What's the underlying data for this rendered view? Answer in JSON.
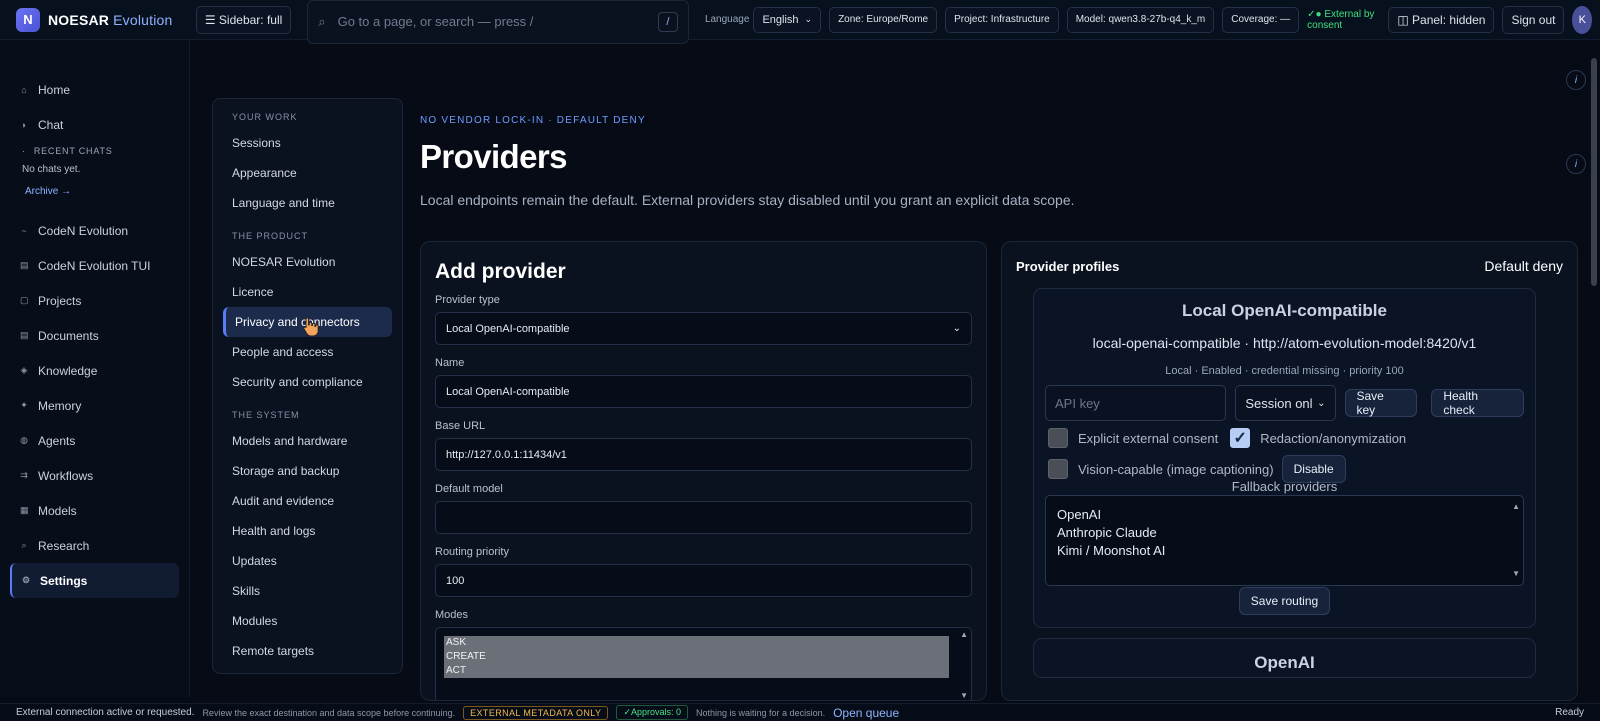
{
  "app": {
    "logo_letter": "N",
    "name": "NOESAR",
    "name_sub": "Evolution"
  },
  "topbar": {
    "sidebar_toggle": "☰ Sidebar: full",
    "search_placeholder": "Go to a page, or search — press /",
    "search_shortcut": "/",
    "language_label": "Language",
    "language_value": "English",
    "zone": "Zone: Europe/Rome",
    "project": "Project: Infrastructure",
    "model": "Model: qwen3.8-27b-q4_k_m",
    "coverage": "Coverage: —",
    "external": "✓● External by consent",
    "panel": "◫ Panel: hidden",
    "sign_out": "Sign out",
    "avatar": "K"
  },
  "sidebar": {
    "items_top": [
      {
        "icon": "⌂",
        "label": "Home"
      },
      {
        "icon": "◗",
        "label": "Chat"
      }
    ],
    "recent_heading": "RECENT CHATS",
    "recent_empty": "No chats yet.",
    "archive": "Archive →",
    "items": [
      {
        "icon": "~",
        "label": "CodeN Evolution"
      },
      {
        "icon": "▤",
        "label": "CodeN Evolution TUI"
      },
      {
        "icon": "▢",
        "label": "Projects"
      },
      {
        "icon": "▤",
        "label": "Documents"
      },
      {
        "icon": "◈",
        "label": "Knowledge"
      },
      {
        "icon": "✦",
        "label": "Memory"
      },
      {
        "icon": "◍",
        "label": "Agents"
      },
      {
        "icon": "⇉",
        "label": "Workflows"
      },
      {
        "icon": "▦",
        "label": "Models"
      },
      {
        "icon": "⌕",
        "label": "Research"
      },
      {
        "icon": "⚙",
        "label": "Settings"
      }
    ]
  },
  "settings_nav": {
    "groups": [
      {
        "heading": "YOUR WORK",
        "items": [
          "Sessions",
          "Appearance",
          "Language and time"
        ]
      },
      {
        "heading": "THE PRODUCT",
        "items": [
          "NOESAR Evolution",
          "Licence",
          "Privacy and connectors",
          "People and access",
          "Security and compliance"
        ]
      },
      {
        "heading": "THE SYSTEM",
        "items": [
          "Models and hardware",
          "Storage and backup",
          "Audit and evidence",
          "Health and logs",
          "Updates",
          "Skills",
          "Modules",
          "Remote targets"
        ]
      }
    ]
  },
  "page": {
    "eyebrow": "NO VENDOR LOCK-IN · DEFAULT DENY",
    "title": "Providers",
    "description": "Local endpoints remain the default. External providers stay disabled until you grant an explicit data scope.",
    "info": "i"
  },
  "add_provider": {
    "title": "Add provider",
    "type_label": "Provider type",
    "type_value": "Local OpenAI-compatible",
    "name_label": "Name",
    "name_value": "Local OpenAI-compatible",
    "url_label": "Base URL",
    "url_value": "http://127.0.0.1:11434/v1",
    "model_label": "Default model",
    "model_value": "",
    "priority_label": "Routing priority",
    "priority_value": "100",
    "modes_label": "Modes",
    "modes": [
      "ASK",
      "CREATE",
      "ACT"
    ]
  },
  "profiles": {
    "title": "Provider profiles",
    "policy": "Default deny",
    "profile": {
      "name": "Local OpenAI-compatible",
      "endpoint": "local-openai-compatible · http://atom-evolution-model:8420/v1",
      "meta": "Local · Enabled · credential missing · priority 100",
      "api_key_placeholder": "API key",
      "session_value": "Session onl",
      "save_key": "Save key",
      "health_check": "Health check",
      "explicit_consent": "Explicit external consent",
      "redaction": "Redaction/anonymization",
      "vision": "Vision-capable (image captioning)",
      "disable": "Disable",
      "fallback_label": "Fallback providers",
      "fallbacks": [
        "OpenAI",
        "Anthropic Claude",
        "Kimi / Moonshot AI"
      ],
      "save_routing": "Save routing"
    },
    "next_profile": "OpenAI"
  },
  "statusbar": {
    "message": "External connection active or requested.",
    "detail": "Review the exact destination and data scope before continuing.",
    "metadata_badge": "EXTERNAL METADATA ONLY",
    "approvals": "✓Approvals: 0",
    "waiting": "Nothing is waiting for a decision.",
    "open_queue": "Open queue",
    "ready": "Ready"
  },
  "colors": {
    "accent": "#5a7cf5",
    "background": "#060b16",
    "green": "#3ee07e",
    "amber": "#f0b849"
  }
}
